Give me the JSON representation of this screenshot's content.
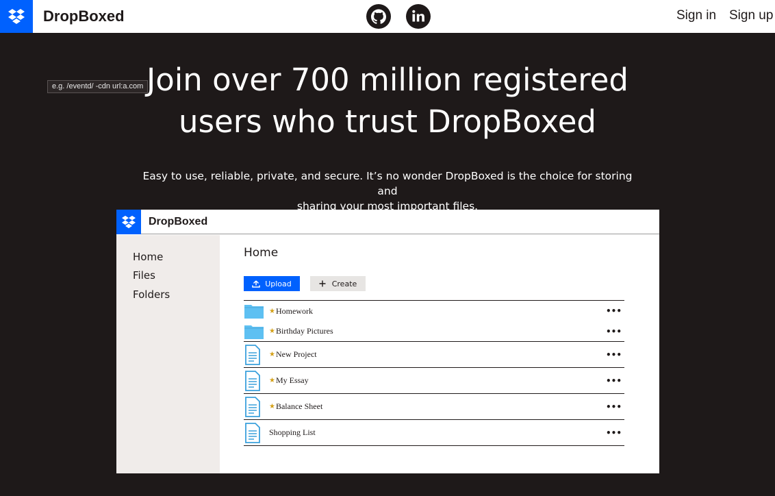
{
  "header": {
    "brand": "DropBoxed",
    "sign_in": "Sign in",
    "sign_up": "Sign up"
  },
  "icons": {
    "logo": "dropbox-logo-icon",
    "social": [
      "github-icon",
      "linkedin-icon"
    ]
  },
  "hero": {
    "tooltip": "e.g. /eventd/ -cdn url:a.com",
    "title_line1": "Join over 700 million registered",
    "title_line2": "users who trust DropBoxed",
    "subtitle_line1": "Easy to use, reliable, private, and secure. It’s no wonder DropBoxed is the choice for storing and",
    "subtitle_line2": "sharing your most important files."
  },
  "preview": {
    "brand": "DropBoxed",
    "sidebar": [
      "Home",
      "Files",
      "Folders"
    ],
    "page_title": "Home",
    "upload_label": "Upload",
    "create_label": "Create",
    "files": [
      {
        "name": "Homework",
        "type": "folder",
        "starred": true
      },
      {
        "name": "Birthday Pictures",
        "type": "folder",
        "starred": true
      },
      {
        "name": "New Project",
        "type": "document",
        "starred": true
      },
      {
        "name": "My Essay",
        "type": "document",
        "starred": true
      },
      {
        "name": "Balance Sheet",
        "type": "document",
        "starred": true
      },
      {
        "name": "Shopping List",
        "type": "document",
        "starred": false
      }
    ],
    "more_label": "•••",
    "star_glyph": "★"
  },
  "colors": {
    "brand_blue": "#0061fe",
    "background": "#1e1919",
    "sidebar": "#f0ecea",
    "folder": "#5ec0f2",
    "star": "#d4a017"
  }
}
